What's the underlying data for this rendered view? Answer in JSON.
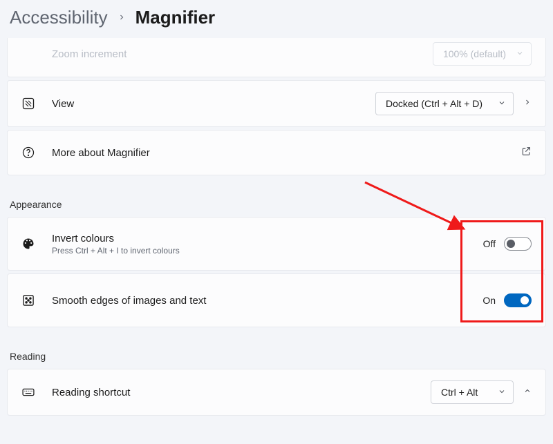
{
  "breadcrumb": {
    "parent": "Accessibility",
    "current": "Magnifier"
  },
  "zoom_increment": {
    "title": "Zoom increment",
    "value": "100% (default)"
  },
  "view": {
    "title": "View",
    "value": "Docked (Ctrl + Alt + D)"
  },
  "more": {
    "title": "More about Magnifier"
  },
  "sections": {
    "appearance": "Appearance",
    "reading": "Reading"
  },
  "invert": {
    "title": "Invert colours",
    "subtitle": "Press Ctrl + Alt + I to invert colours",
    "state_label": "Off"
  },
  "smooth": {
    "title": "Smooth edges of images and text",
    "state_label": "On"
  },
  "reading_shortcut": {
    "title": "Reading shortcut",
    "value": "Ctrl + Alt"
  }
}
